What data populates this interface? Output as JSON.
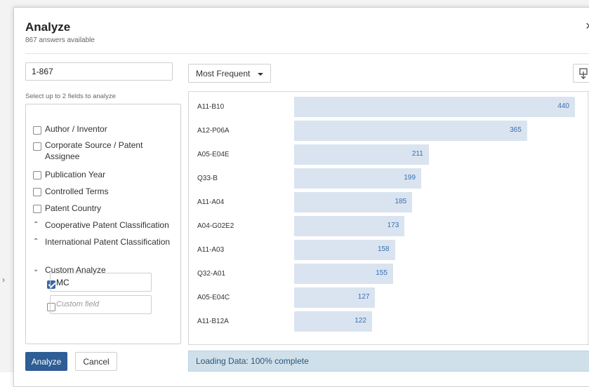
{
  "dialog": {
    "title": "Analyze",
    "subtitle": "867 answers available",
    "close_glyph": "×"
  },
  "range": {
    "value": "1-867"
  },
  "hint": "Select up to 2 fields to analyze",
  "fields": [
    {
      "label": "Author / Inventor",
      "type": "checkbox",
      "checked": false
    },
    {
      "label": "Corporate Source / Patent Assignee",
      "type": "checkbox",
      "checked": false
    },
    {
      "label": "Publication Year",
      "type": "checkbox",
      "checked": false
    },
    {
      "label": "Controlled Terms",
      "type": "checkbox",
      "checked": false
    },
    {
      "label": "Patent Country",
      "type": "checkbox",
      "checked": false
    },
    {
      "label": "Cooperative Patent Classification",
      "type": "expander",
      "state": "collapsed"
    },
    {
      "label": "International Patent Classification",
      "type": "expander",
      "state": "collapsed"
    },
    {
      "label": "Custom Analyze",
      "type": "expander",
      "state": "expanded"
    }
  ],
  "custom": {
    "mc_value": "MC",
    "mc_checked": true,
    "custom_placeholder": "Custom field",
    "custom_checked": false
  },
  "buttons": {
    "analyze": "Analyze",
    "cancel": "Cancel"
  },
  "sort": {
    "selected": "Most Frequent"
  },
  "status": "Loading Data: 100% complete",
  "colors": {
    "primary": "#2f5d95",
    "bar": "#d9e4f0",
    "bar_value": "#3a6fb0",
    "status_bg": "#cfe0eb"
  },
  "chart_data": {
    "type": "bar",
    "orientation": "horizontal",
    "categories": [
      "A11-B10",
      "A12-P06A",
      "A05-E04E",
      "Q33-B",
      "A11-A04",
      "A04-G02E2",
      "A11-A03",
      "Q32-A01",
      "A05-E04C",
      "A11-B12A"
    ],
    "values": [
      440,
      365,
      211,
      199,
      185,
      173,
      158,
      155,
      127,
      122
    ],
    "max": 440
  }
}
